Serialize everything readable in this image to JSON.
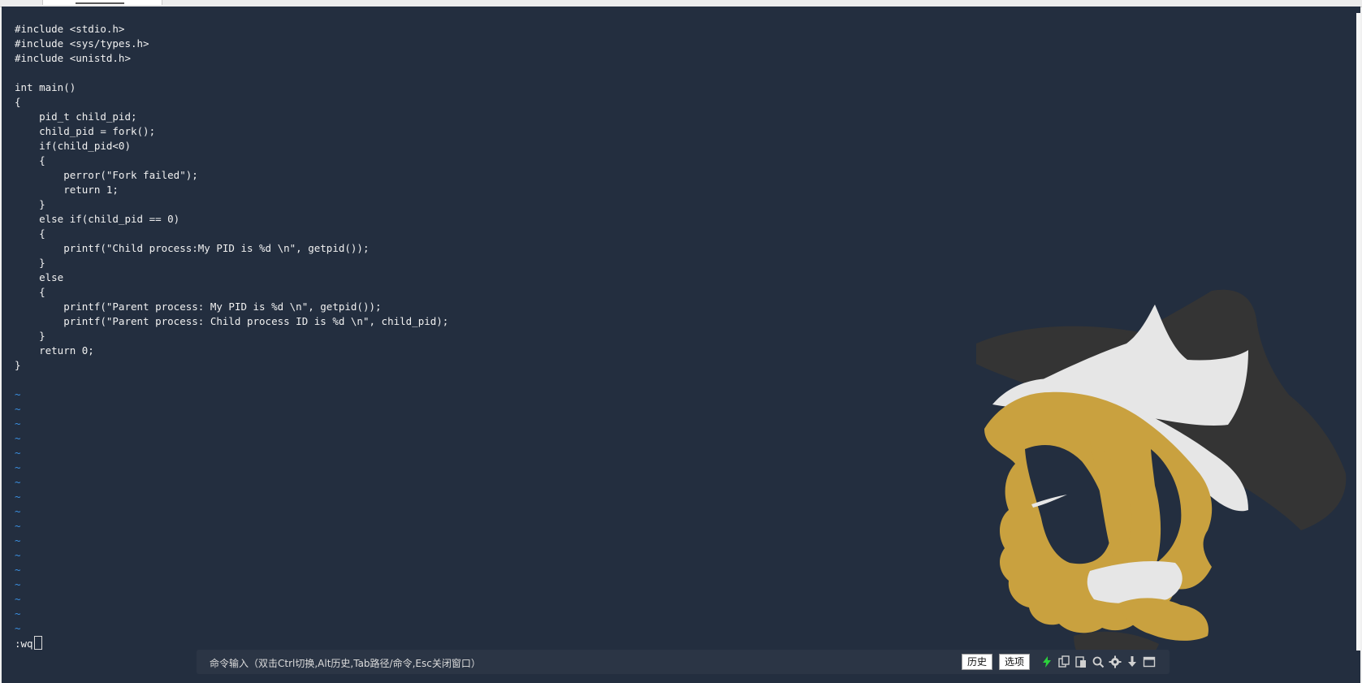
{
  "editor": {
    "code_lines": [
      "#include <stdio.h>",
      "#include <sys/types.h>",
      "#include <unistd.h>",
      "",
      "int main()",
      "{",
      "    pid_t child_pid;",
      "    child_pid = fork();",
      "    if(child_pid<0)",
      "    {",
      "        perror(\"Fork failed\");",
      "        return 1;",
      "    }",
      "    else if(child_pid == 0)",
      "    {",
      "        printf(\"Child process:My PID is %d \\n\", getpid());",
      "    }",
      "    else",
      "    {",
      "        printf(\"Parent process: My PID is %d \\n\", getpid());",
      "        printf(\"Parent process: Child process ID is %d \\n\", child_pid);",
      "    }",
      "    return 0;",
      "}",
      ""
    ],
    "empty_line_marker": "~",
    "empty_lines": [
      "~",
      "~",
      "~",
      "~",
      "~",
      "~",
      "~",
      "~",
      "~",
      "~",
      "~",
      "~",
      "~",
      "~",
      "~",
      "~",
      "~"
    ],
    "command_line": ":wq"
  },
  "command_bar": {
    "placeholder": "命令输入（双击Ctrl切换,Alt历史,Tab路径/命令,Esc关闭窗口）",
    "history_label": "历史",
    "options_label": "选项",
    "icons": [
      "lightning-icon",
      "copy-icon",
      "paste-icon",
      "search-icon",
      "gear-icon",
      "download-icon",
      "window-icon"
    ]
  },
  "colors": {
    "terminal_bg": "#232e3f",
    "text": "#f1f1f1",
    "tilde": "#3b8fe0",
    "art_gold": "#c9a13f",
    "art_dark": "#343434",
    "art_white": "#e6e6e6"
  }
}
